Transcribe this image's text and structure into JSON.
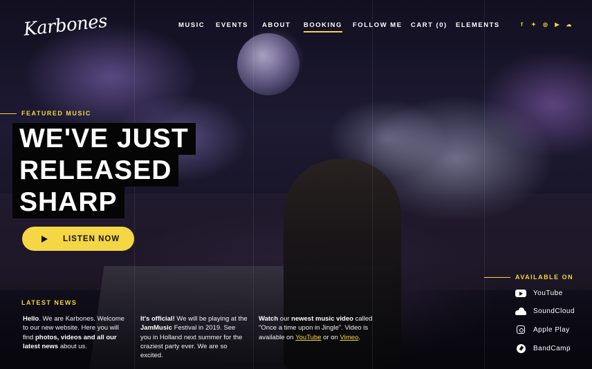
{
  "brand": {
    "logo": "Karbones"
  },
  "nav": {
    "items": [
      {
        "label": "MUSIC",
        "active": false
      },
      {
        "label": "EVENTS",
        "active": false
      },
      {
        "label": "ABOUT",
        "active": false
      },
      {
        "label": "BOOKING",
        "active": true
      },
      {
        "label": "FOLLOW ME",
        "active": false
      },
      {
        "label": "CART (0)",
        "active": false
      },
      {
        "label": "ELEMENTS",
        "active": false
      }
    ]
  },
  "social": [
    "facebook-icon",
    "twitter-icon",
    "instagram-icon",
    "youtube-icon",
    "soundcloud-icon"
  ],
  "colors": {
    "accent": "#f5d745",
    "headline_bg": "#050505"
  },
  "hero": {
    "eyebrow": "FEATURED MUSIC",
    "headline_lines": [
      "WE'VE JUST",
      "RELEASED",
      "SHARP"
    ],
    "cta_label": "LISTEN NOW"
  },
  "news": {
    "title": "LATEST NEWS",
    "col1": {
      "b1": "Hello",
      "t1": ". We are Karbones. Welcome to our new website. Here you will find ",
      "b2": "photos, videos and all our latest news",
      "t2": " about us."
    },
    "col2": {
      "b1": "It's official!",
      "t1": " We will be playing at the ",
      "b2": "JamMusic",
      "t2": " Festival in 2019. See you in Holland next summer for the craziest party ever. We are so excited."
    },
    "col3": {
      "b1": "Watch",
      "t1": " our ",
      "b2": "newest music video",
      "t2": " called \"Once a time upon in Jingle\". Video is available on ",
      "l1": "YouTube",
      "t3": " or on ",
      "l2": "Vimeo",
      "t4": "."
    }
  },
  "available": {
    "title": "AVAILABLE ON",
    "platforms": [
      {
        "label": "YouTube",
        "icon": "youtube-icon"
      },
      {
        "label": "SoundCloud",
        "icon": "soundcloud-icon"
      },
      {
        "label": "Apple Play",
        "icon": "apple-play-icon"
      },
      {
        "label": "BandCamp",
        "icon": "bandcamp-icon"
      }
    ]
  }
}
